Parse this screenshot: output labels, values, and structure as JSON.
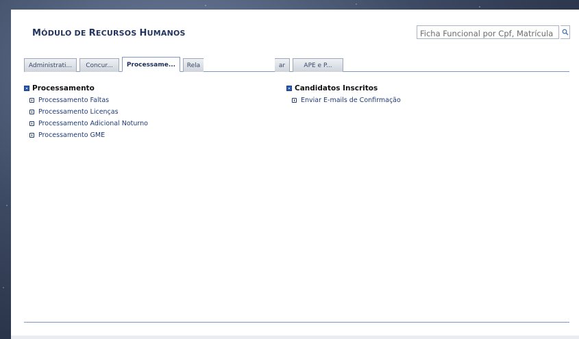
{
  "header": {
    "module_title_prefix": "M",
    "module_title_rest": "ÓDULO DE ",
    "module_title_r": "R",
    "module_title_ecursos": "ECURSOS ",
    "module_title_h": "H",
    "module_title_umanos": "UMANOS",
    "search_value": "Ficha Funcional por Cpf, Matrícula ou",
    "search_icon": "search-icon"
  },
  "tabs": [
    {
      "label": "Administrati...",
      "active": false
    },
    {
      "label": "Concur...",
      "active": false
    },
    {
      "label": "Processame...",
      "active": true
    },
    {
      "label": "Rela",
      "active": false
    },
    {
      "label": "ar",
      "active": false
    },
    {
      "label": "APE e P...",
      "active": false
    }
  ],
  "sections": {
    "processamento": {
      "title": "Processamento",
      "items": [
        "Processamento Faltas",
        "Processamento Licenças",
        "Processamento Adicional Noturno",
        "Processamento GME"
      ]
    },
    "candidatos": {
      "title": "Candidatos Inscritos",
      "items": [
        "Enviar E-mails de Confirmação"
      ]
    }
  },
  "colors": {
    "title": "#23355f",
    "link": "#1e3a74",
    "tab_border": "#7d97c4"
  }
}
